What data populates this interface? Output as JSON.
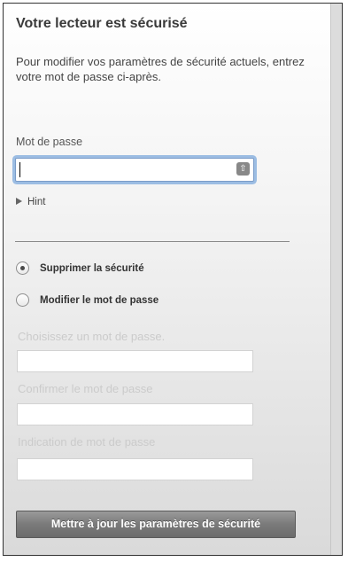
{
  "panel": {
    "title": "Votre lecteur est sécurisé",
    "description": "Pour modifier vos paramètres de sécurité actuels, entrez votre mot de passe ci-après."
  },
  "password": {
    "label": "Mot de passe",
    "value": "",
    "keychain_icon": "keychain-icon"
  },
  "hint": {
    "label": "Hint",
    "expanded": false
  },
  "options": {
    "remove_security": {
      "label": "Supprimer la sécurité",
      "selected": true
    },
    "change_password": {
      "label": "Modifier le mot de passe",
      "selected": false
    }
  },
  "fields": {
    "choose_password": {
      "label": "Choisissez un mot de passe.",
      "value": ""
    },
    "confirm_password": {
      "label": "Confirmer le mot de passe",
      "value": ""
    },
    "password_hint": {
      "label": "Indication de mot de passe",
      "value": ""
    }
  },
  "actions": {
    "update_label": "Mettre à jour les paramètres de sécurité"
  },
  "colors": {
    "focus_ring": "#9cbde3",
    "button_bg": "#7a7a7a",
    "disabled_label": "#cbcbcb"
  }
}
